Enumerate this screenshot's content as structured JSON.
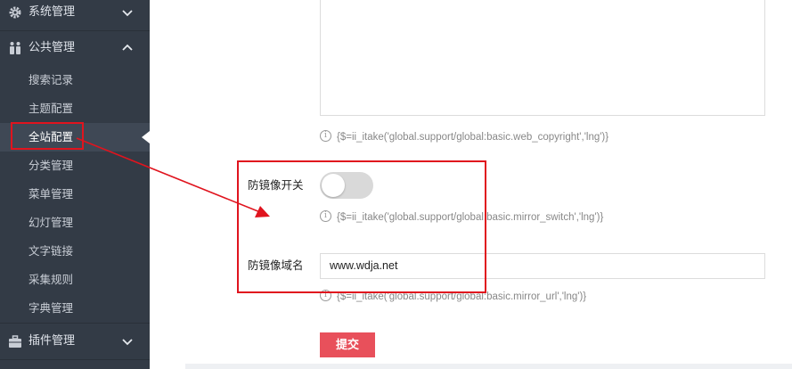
{
  "sidebar": {
    "groups": [
      {
        "label": "系统管理",
        "icon": "gear-icon"
      },
      {
        "label": "公共管理",
        "icon": "people-icon"
      },
      {
        "label": "插件管理",
        "icon": "briefcase-icon"
      }
    ],
    "sub_items": [
      "搜索记录",
      "主题配置",
      "全站配置",
      "分类管理",
      "菜单管理",
      "幻灯管理",
      "文字链接",
      "采集规则",
      "字典管理"
    ],
    "active_sub_item": "全站配置"
  },
  "form": {
    "copyright_hint": "{$=ii_itake('global.support/global:basic.web_copyright','lng')}",
    "mirror_switch": {
      "label": "防镜像开关",
      "on": false,
      "hint": "{$=ii_itake('global.support/global:basic.mirror_switch','lng')}"
    },
    "mirror_url": {
      "label": "防镜像域名",
      "value": "www.wdja.net",
      "hint": "{$=ii_itake('global.support/global:basic.mirror_url','lng')}"
    },
    "submit_label": "提交"
  },
  "colors": {
    "sidebar_bg": "#333b46",
    "submit_bg": "#e8505b",
    "annotation": "#e0141e"
  }
}
